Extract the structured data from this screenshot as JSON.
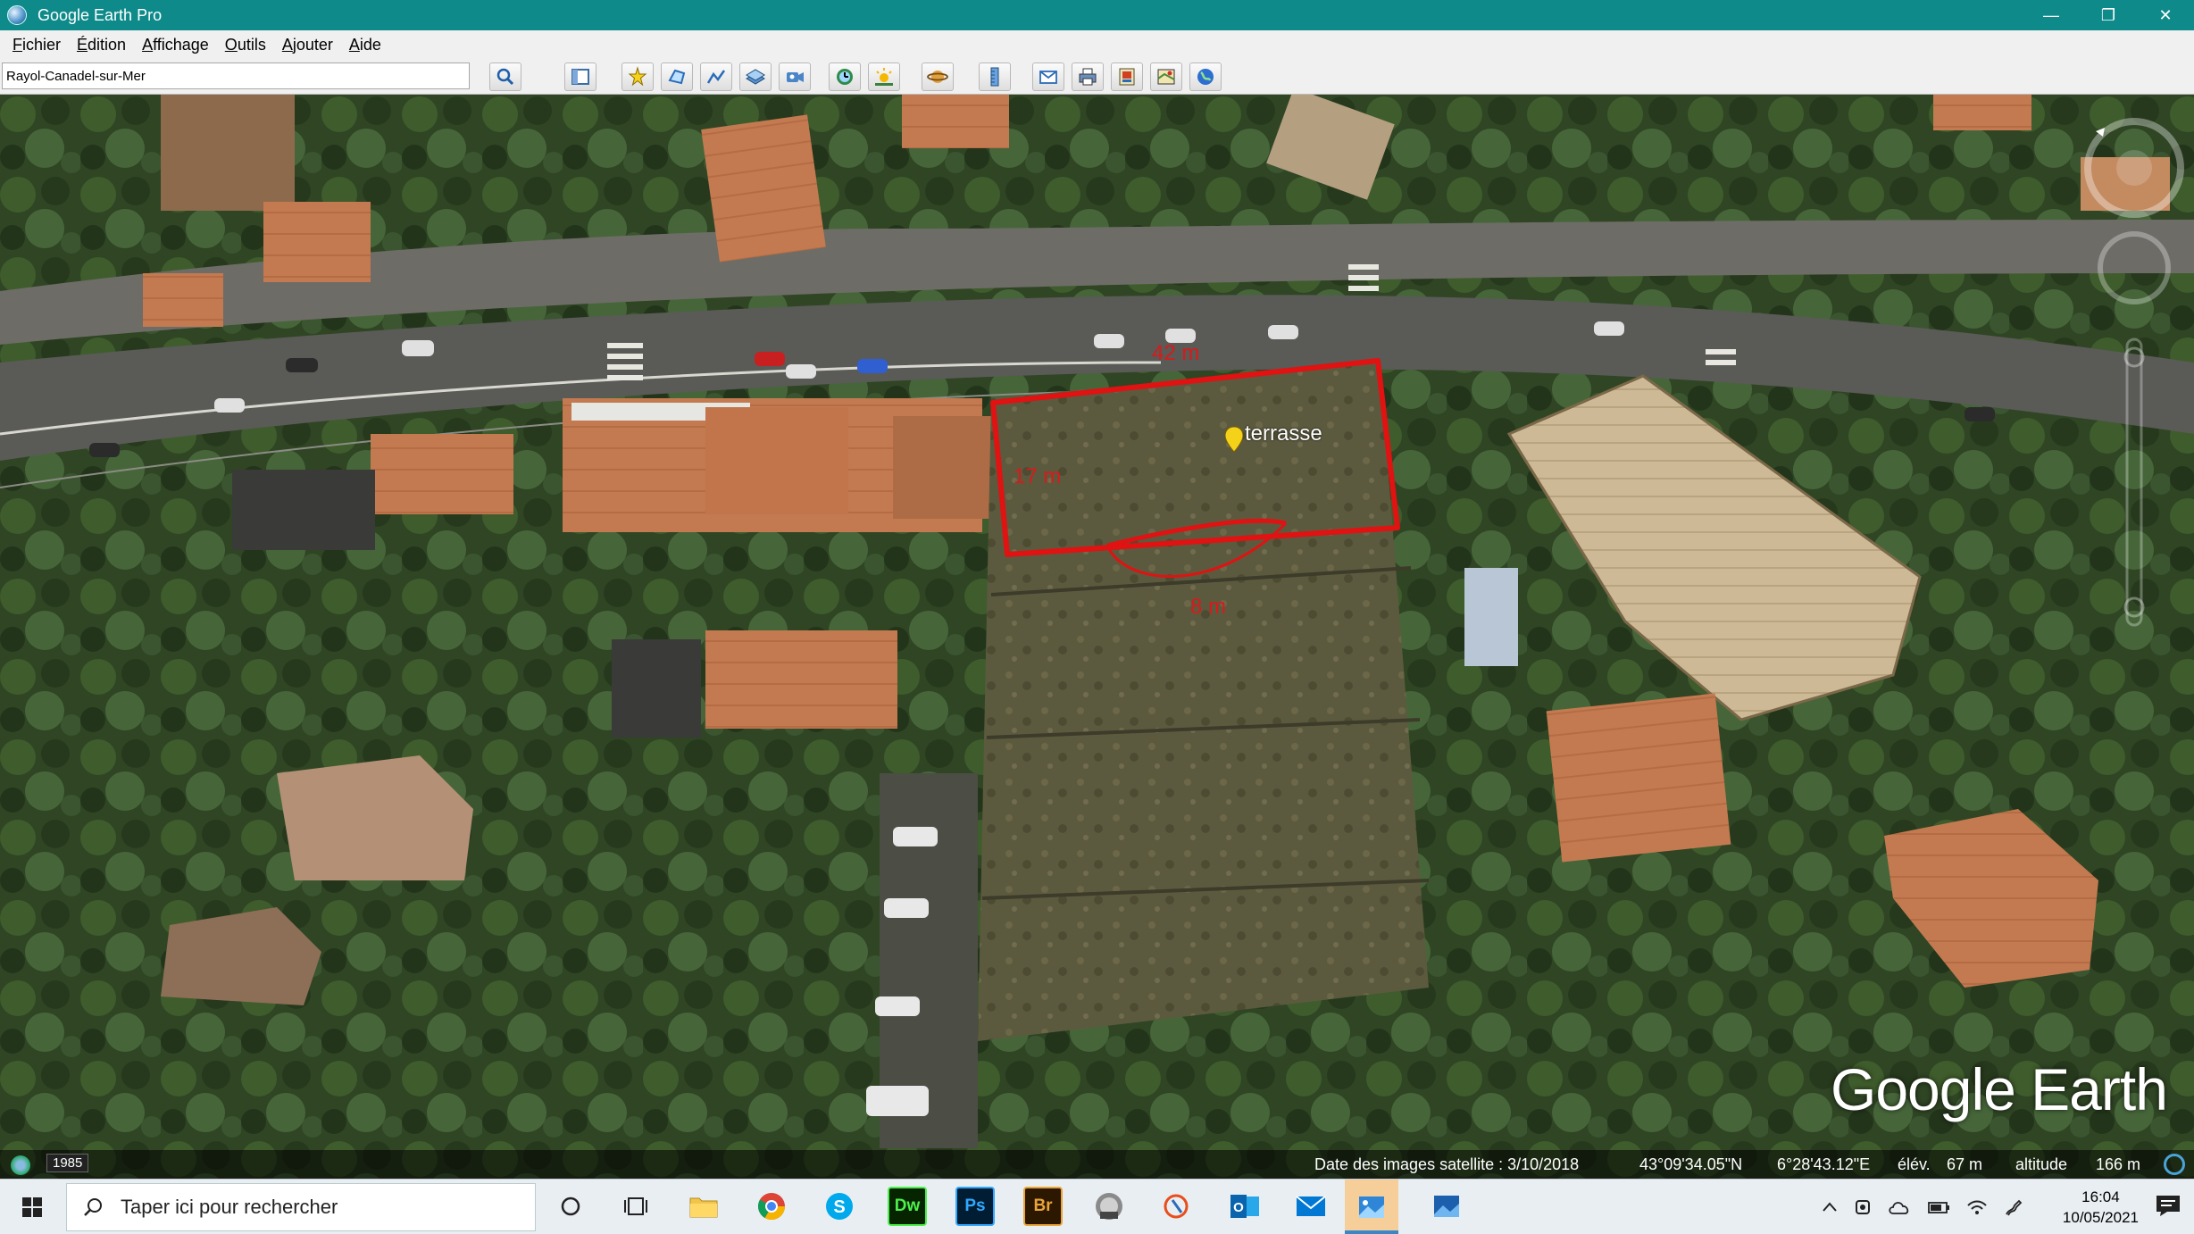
{
  "window": {
    "title": "Google Earth Pro",
    "controls": [
      "—",
      "❐",
      "✕"
    ]
  },
  "menu": [
    "Fichier",
    "Édition",
    "Affichage",
    "Outils",
    "Ajouter",
    "Aide"
  ],
  "search": {
    "value": "Rayol-Canadel-sur-Mer"
  },
  "toolbar": {
    "buttons": [
      "search-button",
      "sidebar-toggle",
      "add-placemark",
      "add-polygon",
      "add-path",
      "add-image-overlay",
      "record-tour",
      "historical-imagery",
      "sunlight",
      "switch-planet",
      "ruler",
      "email",
      "print",
      "save-image",
      "view-in-maps",
      "earth-view"
    ]
  },
  "annotations": {
    "top_length": "42 m",
    "side_length": "17 m",
    "bottom_length": "8 m",
    "placemark": "terrasse"
  },
  "colors": {
    "polygon": "#e01212",
    "titlebar": "#0f8a8a"
  },
  "branding": "Google Earth",
  "statusbar": {
    "year": "1985",
    "imagery_date": "Date des images satellite : 3/10/2018",
    "latitude": "43°09'34.05\"N",
    "longitude": "6°28'43.12\"E",
    "elevation_label": "élév.",
    "elevation": "67 m",
    "altitude_label": "altitude",
    "altitude": "166 m"
  },
  "taskbar": {
    "search_placeholder": "Taper ici pour rechercher",
    "apps": [
      "Dw",
      "Ps",
      "Br"
    ],
    "time": "16:04",
    "date": "10/05/2021"
  }
}
